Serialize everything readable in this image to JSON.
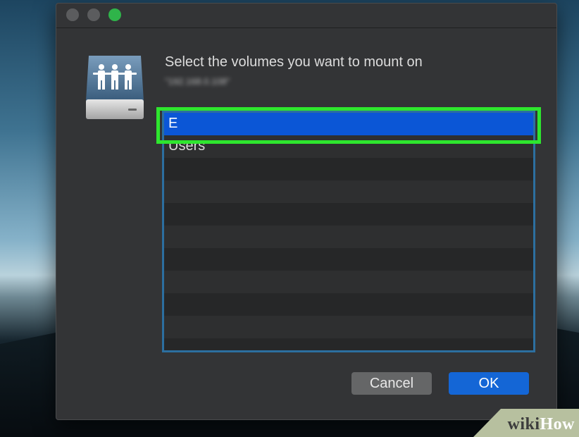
{
  "dialog": {
    "prompt": "Select the volumes you want to mount on",
    "server_address": "\"192.168.0.108\""
  },
  "volumes": [
    {
      "label": "E",
      "selected": true
    },
    {
      "label": "Users",
      "selected": false
    }
  ],
  "buttons": {
    "cancel": "Cancel",
    "ok": "OK"
  },
  "icons": {
    "window_controls": [
      "close-icon",
      "minimize-icon",
      "zoom-icon"
    ],
    "server": "shared-server-icon"
  },
  "watermark": {
    "part1": "wiki",
    "part2": "How"
  },
  "colors": {
    "selection": "#0b56d6",
    "highlight": "#2ee62e",
    "ok_button": "#1466d6"
  }
}
